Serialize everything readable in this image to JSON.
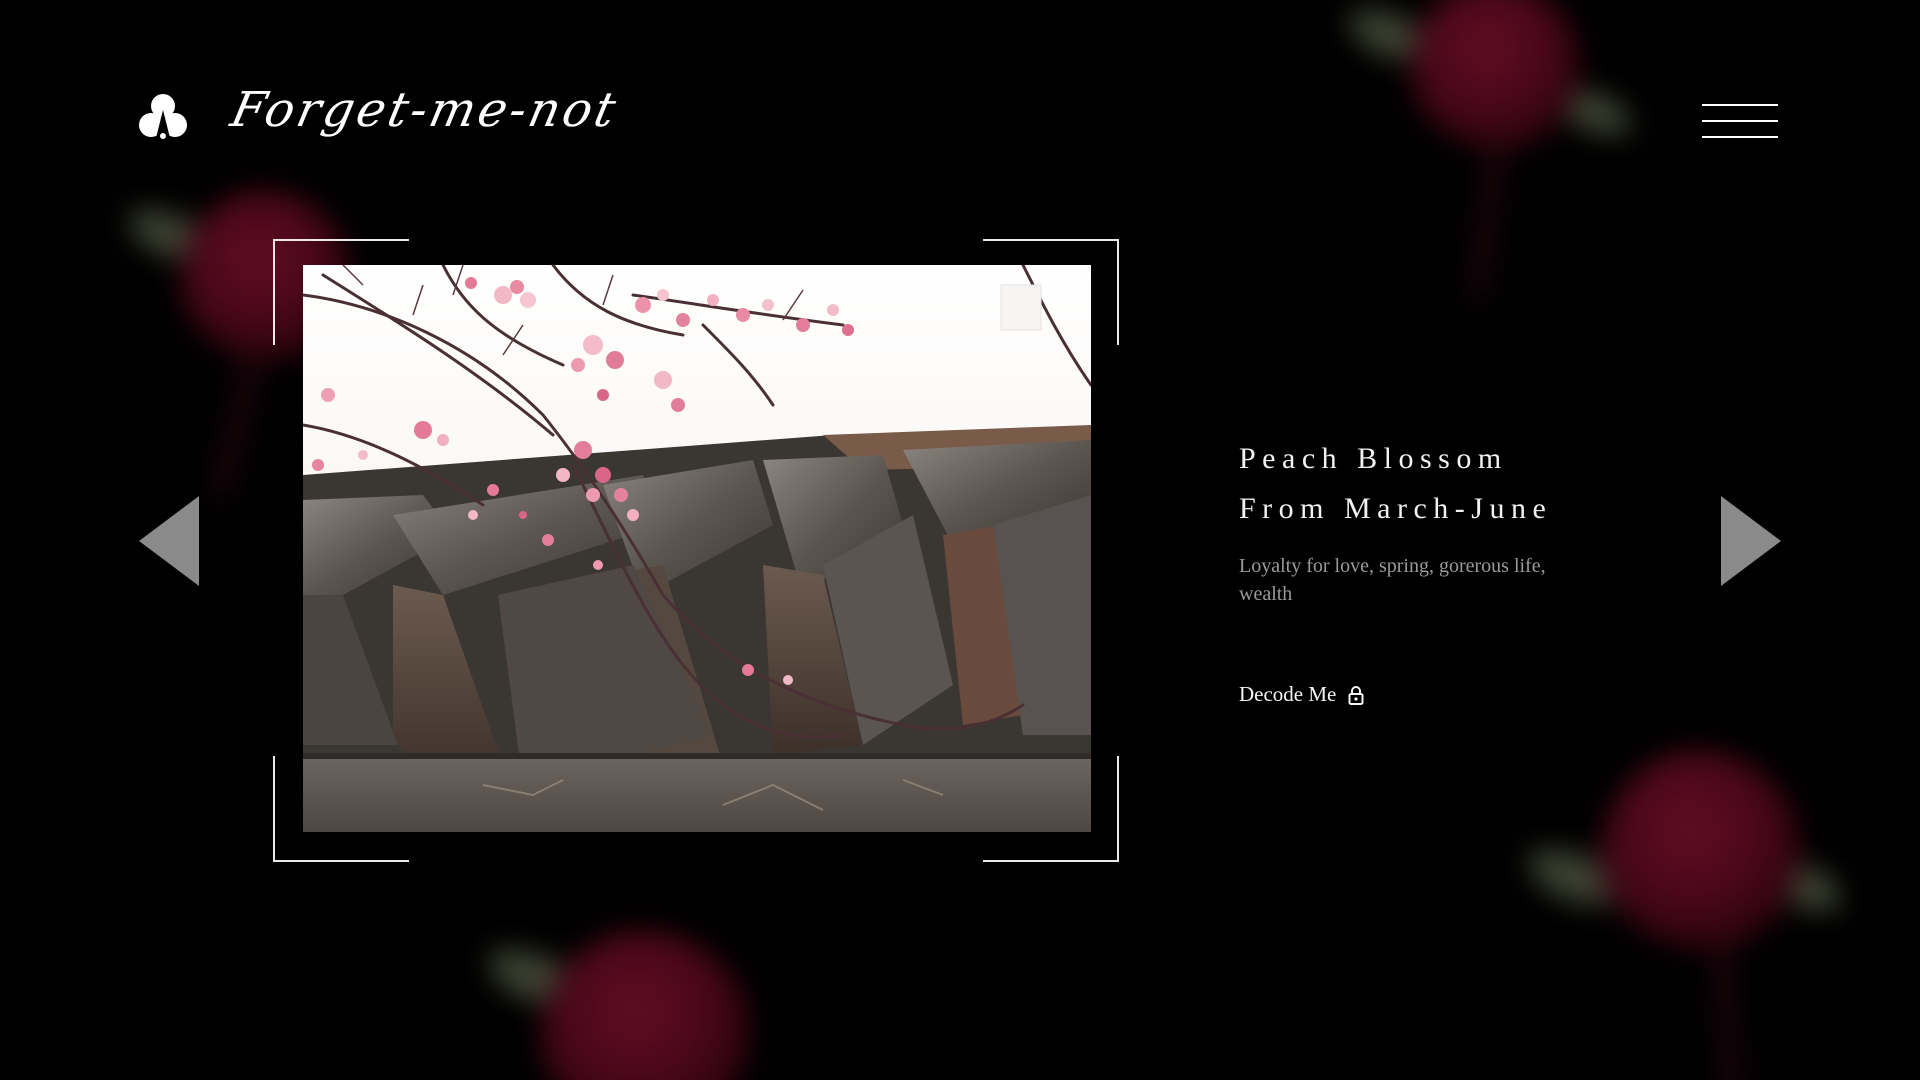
{
  "header": {
    "brand": "Forget-me-not",
    "logo_icon": "flower-logo-icon",
    "menu_icon": "hamburger-menu-icon"
  },
  "slide": {
    "title_line1": "Peach Blossom",
    "title_line2": "From March-June",
    "description": "Loyalty for love, spring, gorerous life, wealth",
    "action_label": "Decode Me",
    "action_icon": "lock-icon",
    "photo_subject": "peach blossom branches over grey roof tiles"
  },
  "navigation": {
    "prev_icon": "triangle-left-icon",
    "next_icon": "triangle-right-icon"
  },
  "colors": {
    "background": "#000000",
    "text": "#f2f2f2",
    "muted_text": "#9a9a9a",
    "arrow": "#8a8a8a",
    "frame": "#e9e9e9",
    "rose": "#8a0f30"
  }
}
